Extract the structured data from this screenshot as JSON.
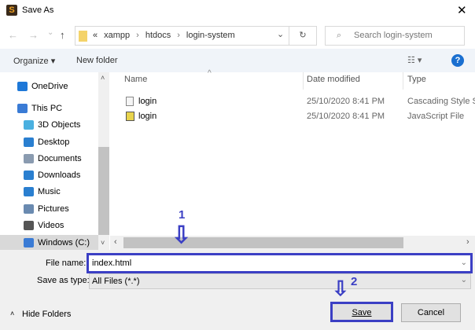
{
  "window": {
    "title": "Save As",
    "close": "✕"
  },
  "nav": {
    "back": "←",
    "forward": "→",
    "recent": "⌄",
    "up": "↑"
  },
  "address": {
    "prefix": "«",
    "crumbs": [
      "xampp",
      "htdocs",
      "login-system"
    ],
    "sep": "›",
    "dropdown": "⌄",
    "refresh": "↻"
  },
  "search": {
    "placeholder": "Search login-system"
  },
  "toolbar": {
    "organize": "Organize ▾",
    "new_folder": "New folder",
    "view": "☷ ▾",
    "help": "?"
  },
  "sidebar": {
    "items": [
      {
        "label": "OneDrive",
        "color": "#1e78d8"
      },
      {
        "label": "This PC",
        "color": "#3a7bd5"
      },
      {
        "label": "3D Objects",
        "color": "#4ab0e0"
      },
      {
        "label": "Desktop",
        "color": "#2a7fd0"
      },
      {
        "label": "Documents",
        "color": "#8a9bb0"
      },
      {
        "label": "Downloads",
        "color": "#2a7fd0"
      },
      {
        "label": "Music",
        "color": "#2a7fd0"
      },
      {
        "label": "Pictures",
        "color": "#6a8ab0"
      },
      {
        "label": "Videos",
        "color": "#555"
      },
      {
        "label": "Windows (C:)",
        "color": "#3a7bd5"
      }
    ]
  },
  "columns": {
    "name": "Name",
    "date": "Date modified",
    "type": "Type",
    "sort": "^"
  },
  "files": [
    {
      "name": "login",
      "date": "25/10/2020 8:41 PM",
      "type": "Cascading Style S..."
    },
    {
      "name": "login",
      "date": "25/10/2020 8:41 PM",
      "type": "JavaScript File"
    }
  ],
  "form": {
    "file_name_label": "File name:",
    "file_name_value": "index.html",
    "save_type_label": "Save as type:",
    "save_type_value": "All Files (*.*)"
  },
  "buttons": {
    "save": "Save",
    "cancel": "Cancel",
    "hide_folders": "Hide Folders"
  },
  "annotations": {
    "step1": "1",
    "step2": "2",
    "arrow": "⇩"
  }
}
